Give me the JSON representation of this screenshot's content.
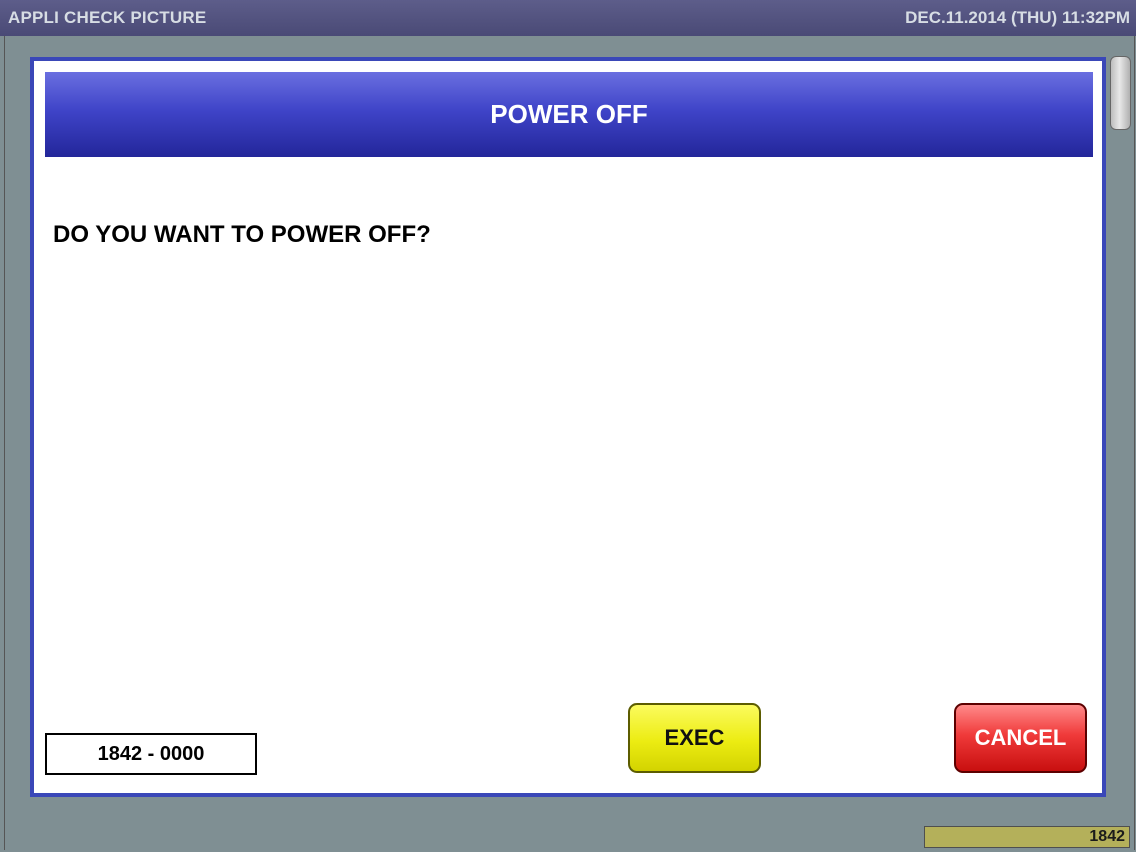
{
  "topbar": {
    "app_title": "APPLI CHECK PICTURE",
    "datetime": "DEC.11.2014 (THU)  11:32PM"
  },
  "dialog": {
    "title": "POWER OFF",
    "question": "DO YOU WANT TO POWER OFF?",
    "code": "1842 - 0000",
    "exec_label": "EXEC",
    "cancel_label": "CANCEL"
  },
  "status": {
    "counter": "1842"
  },
  "colors": {
    "header_blue": "#3f44c8",
    "dialog_border": "#3a47b8",
    "exec_yellow": "#ecec12",
    "cancel_red": "#f03a3a",
    "background": "#7f8f93"
  }
}
